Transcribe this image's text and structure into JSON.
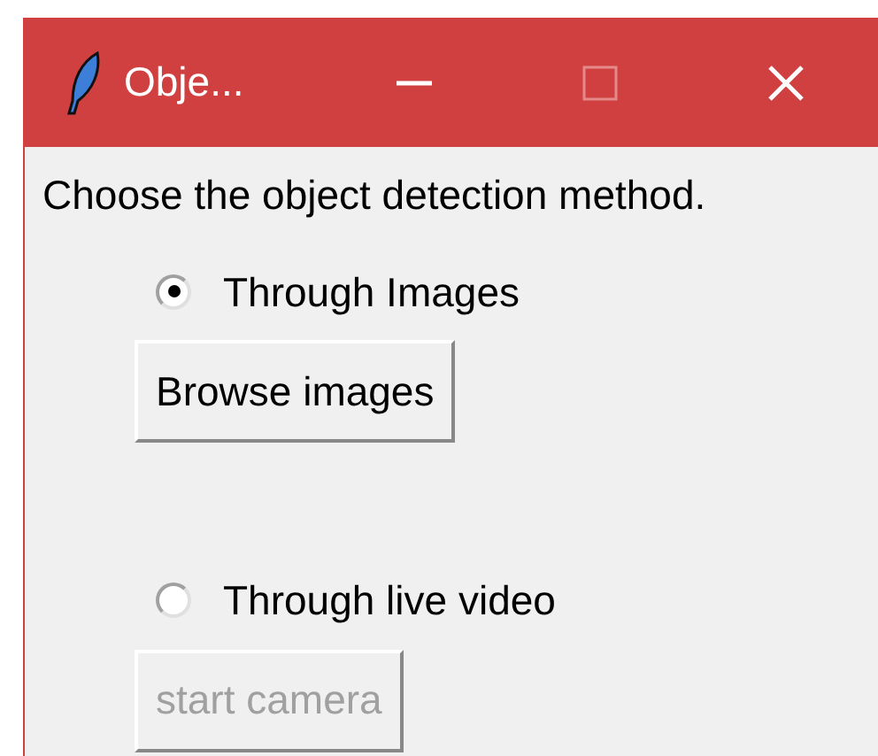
{
  "window": {
    "title": "Obje...",
    "controls": [
      {
        "kind": "minimize",
        "disabled": false
      },
      {
        "kind": "maximize",
        "disabled": true
      },
      {
        "kind": "close",
        "disabled": false
      }
    ]
  },
  "prompt": "Choose the object detection method.",
  "options": [
    {
      "label": "Through Images",
      "selected": true,
      "button": {
        "label": "Browse images",
        "disabled": false
      }
    },
    {
      "label": "Through live video",
      "selected": false,
      "button": {
        "label": "start camera",
        "disabled": true
      }
    }
  ]
}
